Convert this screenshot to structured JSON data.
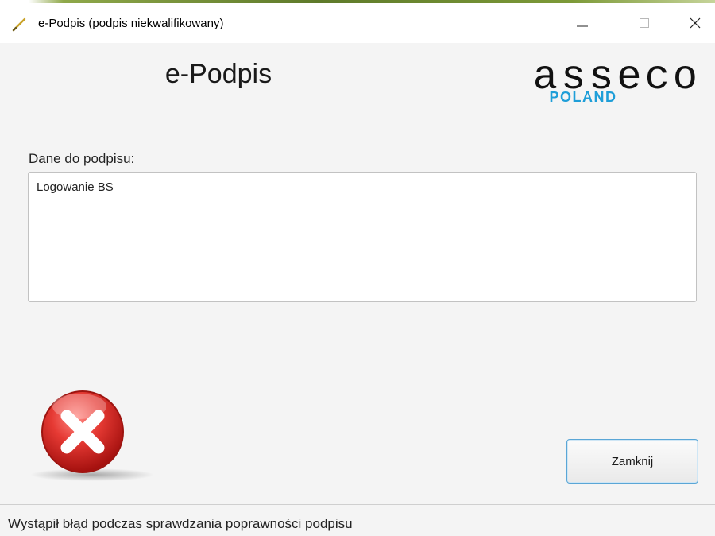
{
  "window": {
    "title": "e-Podpis (podpis niekwalifikowany)",
    "controls": {
      "minimize": "minimize",
      "maximize": "maximize",
      "close": "close"
    }
  },
  "header": {
    "title": "e-Podpis",
    "logo": {
      "wordmark": "asseco",
      "subtitle": "POLAND",
      "subtitle_color": "#1e9ed8"
    }
  },
  "form": {
    "label": "Dane do podpisu:",
    "value": "Logowanie BS"
  },
  "status_icon": "error-x-icon",
  "buttons": {
    "close_label": "Zamknij"
  },
  "status_bar": {
    "message": "Wystąpił błąd podczas sprawdzania poprawności podpisu"
  },
  "colors": {
    "accent_border": "#5aa6d6",
    "error_red": "#e0302f"
  }
}
